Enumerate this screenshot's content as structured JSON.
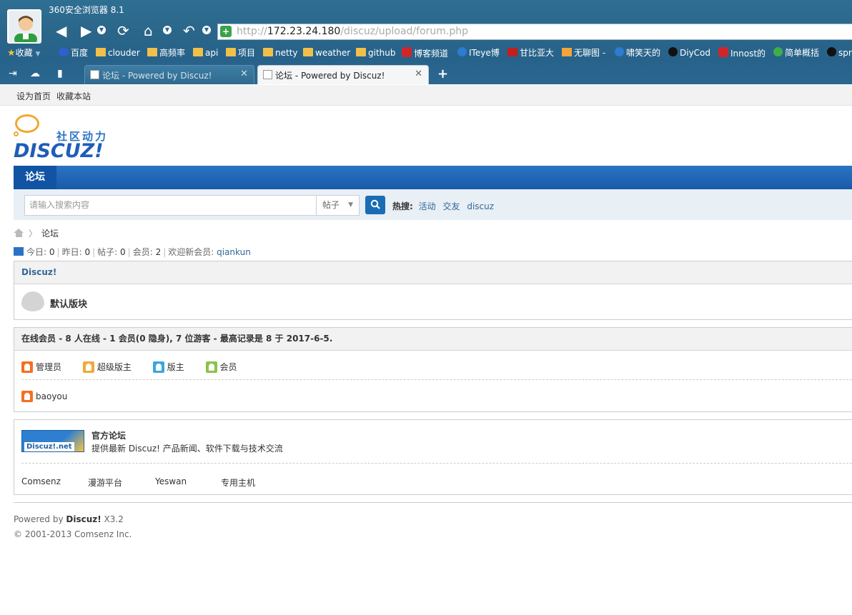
{
  "browser": {
    "title": "360安全浏览器 8.1",
    "url_prefix": "http://",
    "url_host": "172.23.24.180",
    "url_path": "/discuz/upload/forum.php",
    "bookmarks": [
      "收藏",
      "百度",
      "clouder",
      "高频率",
      "api",
      "项目",
      "netty",
      "weather",
      "github",
      "博客频道",
      "ITeye博",
      "甘比亚大",
      "无聊图 -",
      "啸笑天的",
      "DiyCod",
      "Innost的",
      "简单概括",
      "spr"
    ],
    "tabs": [
      {
        "label": "论坛 - Powered by Discuz!",
        "active": false
      },
      {
        "label": "论坛 - Powered by Discuz!",
        "active": true
      }
    ],
    "new_tab": "+"
  },
  "topbar": {
    "set_home": "设为首页",
    "bookmark_site": "收藏本站"
  },
  "logo": {
    "cn": "社区动力",
    "en": "DISCUZ!"
  },
  "nav": {
    "forum": "论坛"
  },
  "search": {
    "placeholder": "请输入搜索内容",
    "type": "帖子",
    "hot_label": "热搜:",
    "hot_items": [
      "活动",
      "交友",
      "discuz"
    ]
  },
  "breadcrumb": {
    "current": "论坛"
  },
  "stats": {
    "today_label": "今日:",
    "today": "0",
    "yesterday_label": "昨日:",
    "yesterday": "0",
    "posts_label": "帖子:",
    "posts": "0",
    "members_label": "会员:",
    "members": "2",
    "welcome_label": "欢迎新会员:",
    "new_member": "qiankun"
  },
  "category": {
    "name": "Discuz!",
    "forum": "默认版块"
  },
  "online": {
    "title": "在线会员",
    "summary": " - 8 人在线 - 1 会员(0 隐身), 7 位游客 - 最高记录是 8 于 2017-6-5.",
    "legend": [
      "管理员",
      "超级版主",
      "版主",
      "会员"
    ],
    "users": [
      "baoyou"
    ]
  },
  "links": {
    "logo_text": "Discuz!.net",
    "title": "官方论坛",
    "desc": "提供最新 Discuz! 产品新闻、软件下载与技术交流",
    "partners": [
      "Comsenz",
      "漫游平台",
      "Yeswan",
      "专用主机"
    ]
  },
  "footer": {
    "powered_prefix": "Powered by ",
    "powered_brand": "Discuz!",
    "version": " X3.2",
    "copyright": "© 2001-2013 Comsenz Inc."
  }
}
